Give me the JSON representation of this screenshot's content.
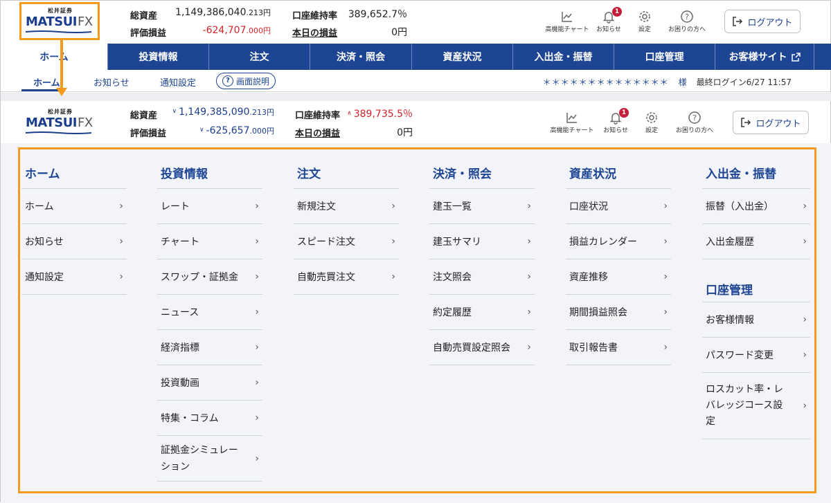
{
  "logo": {
    "sub": "松井証券",
    "main": "MATSUI",
    "fx": "FX"
  },
  "header_top": {
    "total_assets_label": "総資産",
    "total_assets_value": "1,149,386,040",
    "total_assets_decimal": ".213円",
    "unrealized_label": "評価損益",
    "unrealized_value": "-624,707",
    "unrealized_decimal": ".000円",
    "margin_rate_label": "口座維持率",
    "margin_rate_value": "389,652.7％",
    "today_pl_label": "本日の損益",
    "today_pl_value": "0円"
  },
  "header_bottom": {
    "total_assets_label": "総資産",
    "total_assets_value": "1,149,385,090",
    "total_assets_decimal": ".213円",
    "unrealized_label": "評価損益",
    "unrealized_value": "-625,657",
    "unrealized_decimal": ".000円",
    "margin_rate_label": "口座維持率",
    "margin_rate_value": "389,735.5％",
    "today_pl_label": "本日の損益",
    "today_pl_value": "0円"
  },
  "tools": {
    "chart": "高機能チャート",
    "notice": "お知らせ",
    "notice_badge": "1",
    "settings": "設定",
    "help": "お困りの方へ",
    "logout": "ログアウト"
  },
  "nav": [
    {
      "label": "ホーム"
    },
    {
      "label": "投資情報"
    },
    {
      "label": "注文"
    },
    {
      "label": "決済・照会"
    },
    {
      "label": "資産状況"
    },
    {
      "label": "入出金・振替"
    },
    {
      "label": "口座管理"
    },
    {
      "label": "お客様サイト"
    }
  ],
  "subnav": {
    "home": "ホーム",
    "notice": "お知らせ",
    "notify_settings": "通知設定",
    "screen_help": "画面説明",
    "user_stars": "＊＊＊＊＊＊＊＊＊＊＊＊＊＊",
    "user_suffix": "様",
    "last_login": "最終ログイン6/27 11:57"
  },
  "menu": {
    "home": {
      "title": "ホーム",
      "items": [
        "ホーム",
        "お知らせ",
        "通知設定"
      ]
    },
    "invest": {
      "title": "投資情報",
      "items": [
        "レート",
        "チャート",
        "スワップ・証拠金",
        "ニュース",
        "経済指標",
        "投資動画",
        "特集・コラム",
        "証拠金シミュレーション"
      ]
    },
    "order": {
      "title": "注文",
      "items": [
        "新規注文",
        "スピード注文",
        "自動売買注文"
      ]
    },
    "settle": {
      "title": "決済・照会",
      "items": [
        "建玉一覧",
        "建玉サマリ",
        "注文照会",
        "約定履歴",
        "自動売買設定照会"
      ]
    },
    "assets": {
      "title": "資産状況",
      "items": [
        "口座状況",
        "損益カレンダー",
        "資産推移",
        "期間損益照会",
        "取引報告書"
      ]
    },
    "deposit": {
      "title": "入出金・振替",
      "items": [
        "振替（入出金）",
        "入出金履歴"
      ]
    },
    "account": {
      "title": "口座管理",
      "items": [
        "お客様情報",
        "パスワード変更",
        "ロスカット率・レバレッジコース設定"
      ]
    }
  }
}
